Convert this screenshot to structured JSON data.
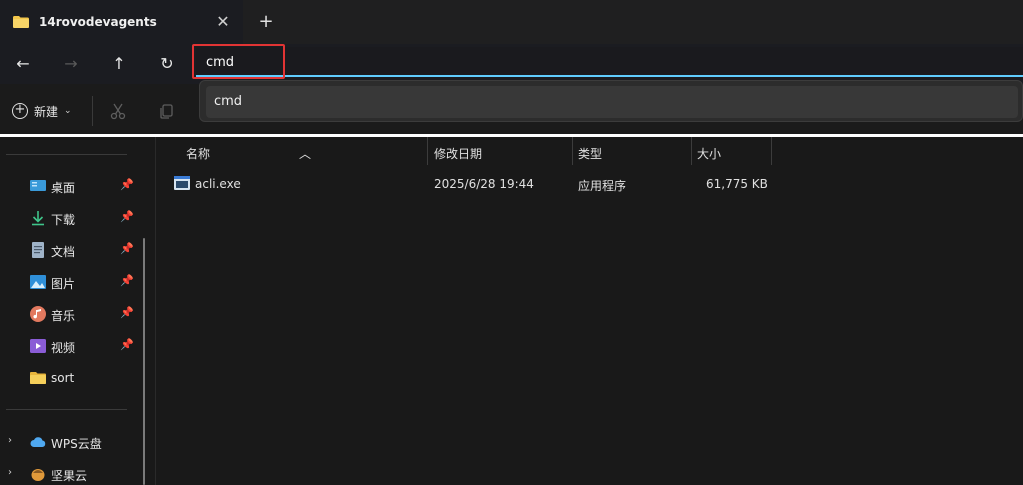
{
  "tab": {
    "title": "14rovodevagents",
    "close_glyph": "✕",
    "new_tab_glyph": "+"
  },
  "nav": {
    "back_glyph": "←",
    "forward_glyph": "→",
    "up_glyph": "↑",
    "refresh_glyph": "↻",
    "address_value": "cmd"
  },
  "suggestion": {
    "text": "cmd"
  },
  "commandbar": {
    "new_label": "新建",
    "new_chevron": "⌄"
  },
  "sidebar": {
    "items": [
      {
        "label": "桌面",
        "icon": "desktop-icon",
        "pinned": true
      },
      {
        "label": "下载",
        "icon": "download-icon",
        "pinned": true
      },
      {
        "label": "文档",
        "icon": "documents-icon",
        "pinned": true
      },
      {
        "label": "图片",
        "icon": "pictures-icon",
        "pinned": true
      },
      {
        "label": "音乐",
        "icon": "music-icon",
        "pinned": true
      },
      {
        "label": "视频",
        "icon": "videos-icon",
        "pinned": true
      },
      {
        "label": "sort",
        "icon": "folder-icon",
        "pinned": false
      }
    ],
    "drives": [
      {
        "label": "WPS云盘",
        "icon": "wps-cloud-icon"
      },
      {
        "label": "坚果云",
        "icon": "nutstore-icon"
      }
    ]
  },
  "columns": {
    "name": "名称",
    "modified": "修改日期",
    "type": "类型",
    "size": "大小"
  },
  "files": [
    {
      "name": "acli.exe",
      "modified": "2025/6/28 19:44",
      "type": "应用程序",
      "size": "61,775 KB"
    }
  ],
  "colors": {
    "accent": "#60cdff",
    "highlight": "#e23434",
    "folder": "#f3c64a"
  }
}
